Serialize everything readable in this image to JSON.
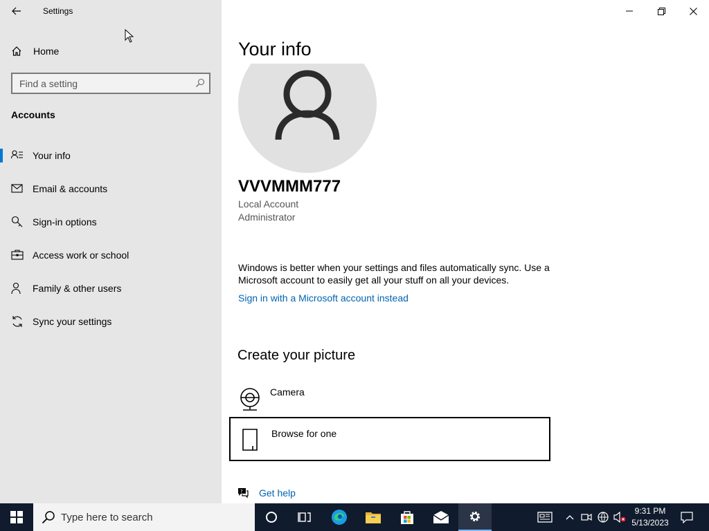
{
  "window": {
    "title": "Settings"
  },
  "sidebar": {
    "home_label": "Home",
    "search_placeholder": "Find a setting",
    "section_title": "Accounts",
    "items": [
      {
        "label": "Your info",
        "icon": "your-info-icon",
        "selected": true
      },
      {
        "label": "Email & accounts",
        "icon": "email-icon"
      },
      {
        "label": "Sign-in options",
        "icon": "key-icon"
      },
      {
        "label": "Access work or school",
        "icon": "briefcase-icon"
      },
      {
        "label": "Family & other users",
        "icon": "person-icon"
      },
      {
        "label": "Sync your settings",
        "icon": "sync-icon"
      }
    ]
  },
  "main": {
    "title": "Your info",
    "user_name": "VVVMMM777",
    "account_type": "Local Account",
    "account_role": "Administrator",
    "sync_text": "Windows is better when your settings and files automatically sync. Use a Microsoft account to easily get all your stuff on all your devices.",
    "sign_in_link": "Sign in with a Microsoft account instead",
    "create_picture_title": "Create your picture",
    "picture_options": [
      {
        "label": "Camera",
        "icon": "camera-icon"
      },
      {
        "label": "Browse for one",
        "icon": "file-icon"
      }
    ],
    "help_label": "Get help"
  },
  "taskbar": {
    "search_placeholder": "Type here to search",
    "time": "9:31 PM",
    "date": "5/13/2023"
  },
  "colors": {
    "accent": "#0078d4",
    "link": "#0063b1",
    "sidebar_bg": "#e6e6e6",
    "taskbar_bg": "#101b2d"
  }
}
